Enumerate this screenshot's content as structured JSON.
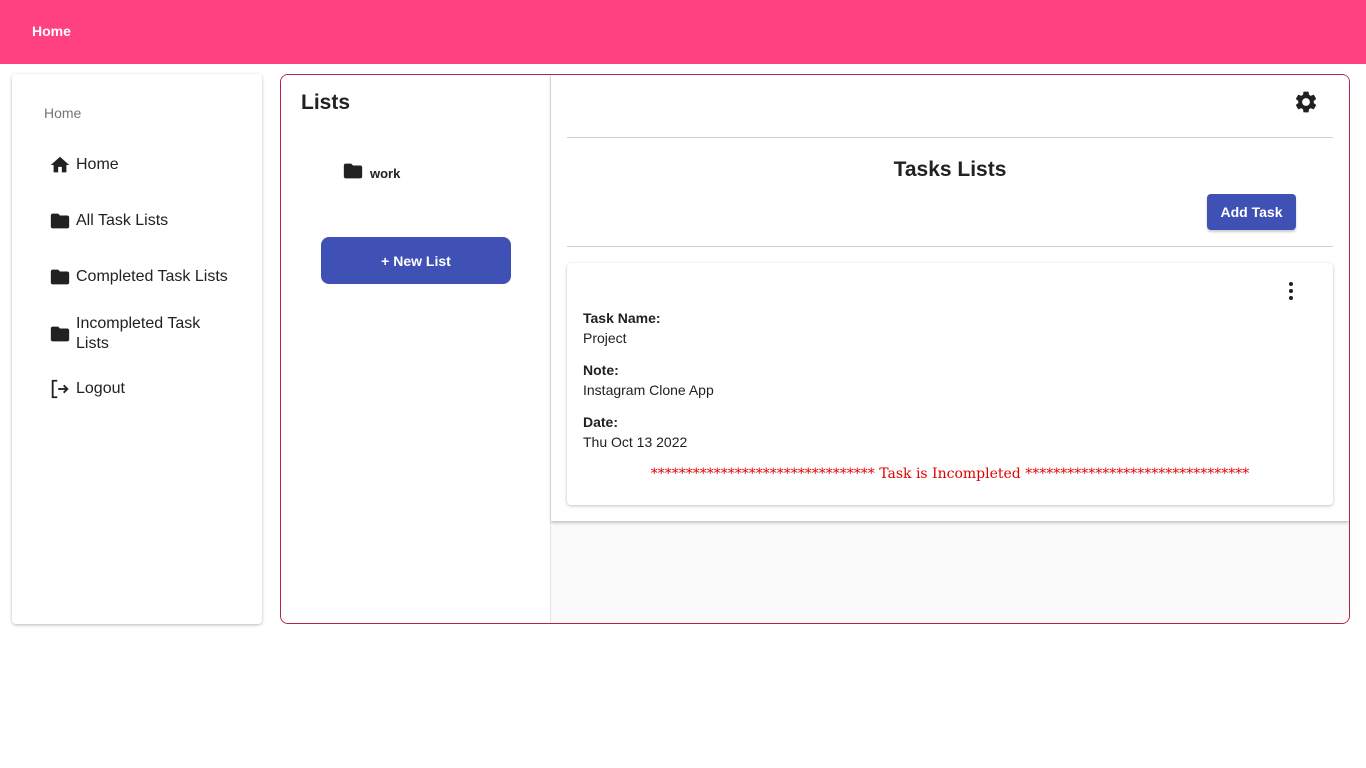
{
  "topbar": {
    "title": "Home"
  },
  "sidebar": {
    "header": "Home",
    "items": [
      {
        "label": "Home",
        "icon": "home-icon"
      },
      {
        "label": "All Task Lists",
        "icon": "folder-icon"
      },
      {
        "label": "Completed Task Lists",
        "icon": "folder-icon"
      },
      {
        "label": "Incompleted Task Lists",
        "icon": "folder-icon"
      },
      {
        "label": "Logout",
        "icon": "logout-icon"
      }
    ]
  },
  "lists": {
    "title": "Lists",
    "items": [
      {
        "label": "work",
        "icon": "folder-icon"
      }
    ],
    "new_list_label": "+ New List"
  },
  "tasks": {
    "title": "Tasks Lists",
    "add_task_label": "Add Task",
    "settings_icon": "gear-icon",
    "cards": [
      {
        "task_name_label": "Task Name:",
        "task_name": "Project",
        "note_label": "Note:",
        "note": "Instagram Clone App",
        "date_label": "Date:",
        "date": "Thu Oct 13 2022",
        "status": "******************************** Task is Incompleted ********************************",
        "menu_icon": "more-vertical-icon"
      }
    ]
  },
  "colors": {
    "topbar": "#ff4081",
    "primary": "#3f51b5",
    "panel_border": "#b3243e",
    "status_text": "#e00000"
  }
}
